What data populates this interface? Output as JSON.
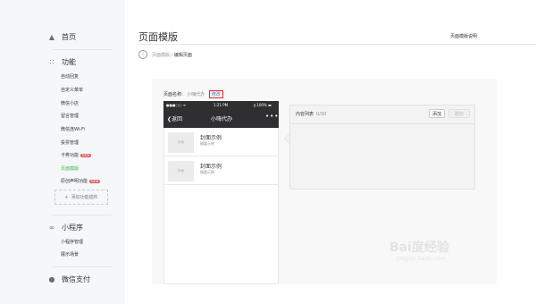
{
  "sidebar": {
    "home": {
      "label": "首页",
      "icon": "home-icon"
    },
    "features": {
      "label": "功能",
      "icon": "grid-icon",
      "items": [
        {
          "label": "自动回复"
        },
        {
          "label": "自定义菜单"
        },
        {
          "label": "微信小店"
        },
        {
          "label": "留言管理"
        },
        {
          "label": "微信连Wi-Fi"
        },
        {
          "label": "投票管理"
        },
        {
          "label": "卡券功能",
          "badge": "NEW"
        },
        {
          "label": "页面模版",
          "active": true
        },
        {
          "label": "原创声明功能",
          "badge": "NEW"
        }
      ],
      "add_plugin": "添加功能插件"
    },
    "miniprogram": {
      "label": "小程序",
      "icon": "link-icon",
      "items": [
        {
          "label": "小程序管理"
        },
        {
          "label": "展示场景"
        }
      ]
    },
    "wechat_pay": {
      "label": "微信支付",
      "icon": "pay-icon"
    }
  },
  "main": {
    "title": "页面模版",
    "top_right": "页面模版说明",
    "breadcrumb": {
      "parent": "页面模版",
      "separator": "/",
      "current": "编辑页面"
    },
    "page_name_label": "页面名称:",
    "page_name_value": "小嗨代办",
    "edit_link": "修改",
    "phone": {
      "status_left": "●●●○○ ᯤ",
      "status_time": "1:21 PM",
      "status_right": "∦ 100% ▬",
      "nav_back": "返回",
      "nav_title": "小嗨代办",
      "nav_more": "•••",
      "cards": [
        {
          "thumb": "封面",
          "title": "封面示例",
          "subtitle": "摘要示例"
        },
        {
          "thumb": "封面",
          "title": "封面示例",
          "subtitle": "摘要示例"
        }
      ]
    },
    "panel": {
      "label": "内容列表",
      "count": "0/30",
      "add_button": "添加",
      "delete_button": "删除"
    }
  },
  "watermark": {
    "main": "Bai度经验",
    "sub": "jingyan.baidu.com"
  }
}
